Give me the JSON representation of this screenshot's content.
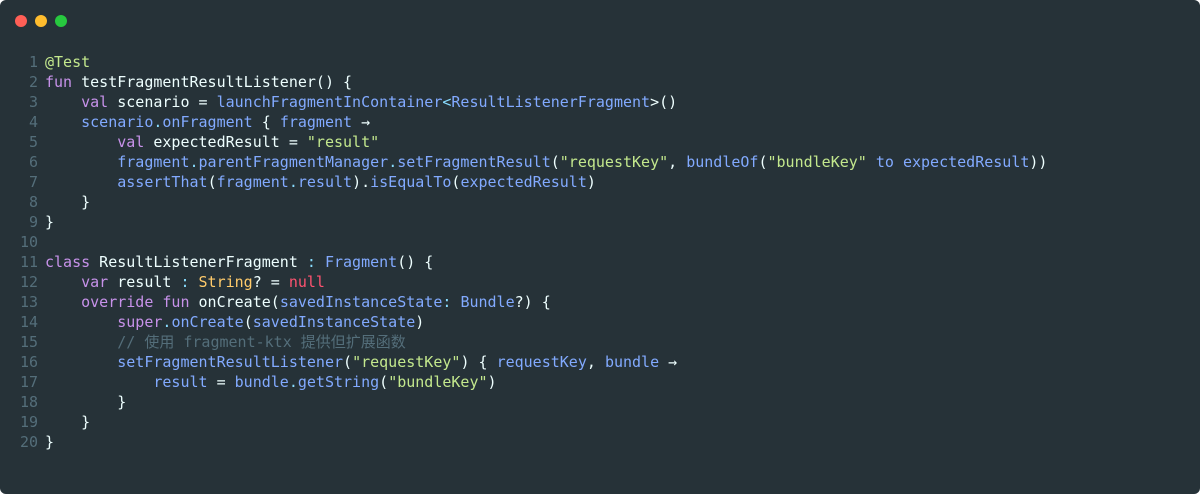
{
  "window": {
    "background": "#263238",
    "buttons": [
      {
        "name": "close",
        "color": "#ff5f56"
      },
      {
        "name": "minimize",
        "color": "#ffbd2e"
      },
      {
        "name": "maximize",
        "color": "#27c93f"
      }
    ]
  },
  "code": {
    "language": "kotlin",
    "lines": [
      {
        "n": "1",
        "tokens": [
          {
            "t": "@Test",
            "c": "#c3e88d"
          }
        ]
      },
      {
        "n": "2",
        "tokens": [
          {
            "t": "fun",
            "c": "#c792ea"
          },
          {
            "t": " testFragmentResultListener() {",
            "c": "#eeffff"
          }
        ]
      },
      {
        "n": "3",
        "tokens": [
          {
            "t": "    ",
            "c": "#eeffff"
          },
          {
            "t": "val",
            "c": "#c792ea"
          },
          {
            "t": " scenario = ",
            "c": "#eeffff"
          },
          {
            "t": "launchFragmentInContainer",
            "c": "#82aaff"
          },
          {
            "t": "<",
            "c": "#89ddff"
          },
          {
            "t": "ResultListenerFragment",
            "c": "#82aaff"
          },
          {
            "t": ">()",
            "c": "#eeffff"
          }
        ]
      },
      {
        "n": "4",
        "tokens": [
          {
            "t": "    ",
            "c": "#eeffff"
          },
          {
            "t": "scenario",
            "c": "#82aaff"
          },
          {
            "t": ".",
            "c": "#89ddff"
          },
          {
            "t": "onFragment",
            "c": "#82aaff"
          },
          {
            "t": " { ",
            "c": "#eeffff"
          },
          {
            "t": "fragment",
            "c": "#82aaff"
          },
          {
            "t": " →",
            "c": "#eeffff"
          }
        ]
      },
      {
        "n": "5",
        "tokens": [
          {
            "t": "        ",
            "c": "#eeffff"
          },
          {
            "t": "val",
            "c": "#c792ea"
          },
          {
            "t": " expectedResult = ",
            "c": "#eeffff"
          },
          {
            "t": "\"result\"",
            "c": "#c3e88d"
          }
        ]
      },
      {
        "n": "6",
        "tokens": [
          {
            "t": "        ",
            "c": "#eeffff"
          },
          {
            "t": "fragment",
            "c": "#82aaff"
          },
          {
            "t": ".",
            "c": "#89ddff"
          },
          {
            "t": "parentFragmentManager",
            "c": "#82aaff"
          },
          {
            "t": ".",
            "c": "#89ddff"
          },
          {
            "t": "setFragmentResult",
            "c": "#82aaff"
          },
          {
            "t": "(",
            "c": "#eeffff"
          },
          {
            "t": "\"requestKey\"",
            "c": "#c3e88d"
          },
          {
            "t": ", ",
            "c": "#eeffff"
          },
          {
            "t": "bundleOf",
            "c": "#82aaff"
          },
          {
            "t": "(",
            "c": "#eeffff"
          },
          {
            "t": "\"bundleKey\"",
            "c": "#c3e88d"
          },
          {
            "t": " ",
            "c": "#eeffff"
          },
          {
            "t": "to",
            "c": "#82aaff"
          },
          {
            "t": " ",
            "c": "#eeffff"
          },
          {
            "t": "expectedResult",
            "c": "#82aaff"
          },
          {
            "t": "))",
            "c": "#eeffff"
          }
        ]
      },
      {
        "n": "7",
        "tokens": [
          {
            "t": "        ",
            "c": "#eeffff"
          },
          {
            "t": "assertThat",
            "c": "#82aaff"
          },
          {
            "t": "(",
            "c": "#eeffff"
          },
          {
            "t": "fragment",
            "c": "#82aaff"
          },
          {
            "t": ".",
            "c": "#89ddff"
          },
          {
            "t": "result",
            "c": "#82aaff"
          },
          {
            "t": ").",
            "c": "#eeffff"
          },
          {
            "t": "isEqualTo",
            "c": "#82aaff"
          },
          {
            "t": "(",
            "c": "#eeffff"
          },
          {
            "t": "expectedResult",
            "c": "#82aaff"
          },
          {
            "t": ")",
            "c": "#eeffff"
          }
        ]
      },
      {
        "n": "8",
        "tokens": [
          {
            "t": "    }",
            "c": "#eeffff"
          }
        ]
      },
      {
        "n": "9",
        "tokens": [
          {
            "t": "}",
            "c": "#eeffff"
          }
        ]
      },
      {
        "n": "10",
        "tokens": []
      },
      {
        "n": "11",
        "tokens": [
          {
            "t": "class",
            "c": "#c792ea"
          },
          {
            "t": " ResultListenerFragment ",
            "c": "#eeffff"
          },
          {
            "t": ":",
            "c": "#89ddff"
          },
          {
            "t": " ",
            "c": "#eeffff"
          },
          {
            "t": "Fragment",
            "c": "#82aaff"
          },
          {
            "t": "() {",
            "c": "#eeffff"
          }
        ]
      },
      {
        "n": "12",
        "tokens": [
          {
            "t": "    ",
            "c": "#eeffff"
          },
          {
            "t": "var",
            "c": "#c792ea"
          },
          {
            "t": " result ",
            "c": "#eeffff"
          },
          {
            "t": ":",
            "c": "#89ddff"
          },
          {
            "t": " ",
            "c": "#eeffff"
          },
          {
            "t": "String",
            "c": "#ffcb6b"
          },
          {
            "t": "? = ",
            "c": "#eeffff"
          },
          {
            "t": "null",
            "c": "#ff5370"
          }
        ]
      },
      {
        "n": "13",
        "tokens": [
          {
            "t": "    ",
            "c": "#eeffff"
          },
          {
            "t": "override fun",
            "c": "#c792ea"
          },
          {
            "t": " onCreate(",
            "c": "#eeffff"
          },
          {
            "t": "savedInstanceState",
            "c": "#82aaff"
          },
          {
            "t": ": ",
            "c": "#89ddff"
          },
          {
            "t": "Bundle",
            "c": "#82aaff"
          },
          {
            "t": "?) {",
            "c": "#eeffff"
          }
        ]
      },
      {
        "n": "14",
        "tokens": [
          {
            "t": "        ",
            "c": "#eeffff"
          },
          {
            "t": "super",
            "c": "#c792ea"
          },
          {
            "t": ".",
            "c": "#89ddff"
          },
          {
            "t": "onCreate",
            "c": "#82aaff"
          },
          {
            "t": "(",
            "c": "#eeffff"
          },
          {
            "t": "savedInstanceState",
            "c": "#82aaff"
          },
          {
            "t": ")",
            "c": "#eeffff"
          }
        ]
      },
      {
        "n": "15",
        "tokens": [
          {
            "t": "        ",
            "c": "#eeffff"
          },
          {
            "t": "// 使用 fragment-ktx 提供但扩展函数",
            "c": "#546e7a"
          }
        ]
      },
      {
        "n": "16",
        "tokens": [
          {
            "t": "        ",
            "c": "#eeffff"
          },
          {
            "t": "setFragmentResultListener",
            "c": "#82aaff"
          },
          {
            "t": "(",
            "c": "#eeffff"
          },
          {
            "t": "\"requestKey\"",
            "c": "#c3e88d"
          },
          {
            "t": ") { ",
            "c": "#eeffff"
          },
          {
            "t": "requestKey",
            "c": "#82aaff"
          },
          {
            "t": ", ",
            "c": "#eeffff"
          },
          {
            "t": "bundle",
            "c": "#82aaff"
          },
          {
            "t": " →",
            "c": "#eeffff"
          }
        ]
      },
      {
        "n": "17",
        "tokens": [
          {
            "t": "            ",
            "c": "#eeffff"
          },
          {
            "t": "result",
            "c": "#82aaff"
          },
          {
            "t": " = ",
            "c": "#eeffff"
          },
          {
            "t": "bundle",
            "c": "#82aaff"
          },
          {
            "t": ".",
            "c": "#89ddff"
          },
          {
            "t": "getString",
            "c": "#82aaff"
          },
          {
            "t": "(",
            "c": "#eeffff"
          },
          {
            "t": "\"bundleKey\"",
            "c": "#c3e88d"
          },
          {
            "t": ")",
            "c": "#eeffff"
          }
        ]
      },
      {
        "n": "18",
        "tokens": [
          {
            "t": "        }",
            "c": "#eeffff"
          }
        ]
      },
      {
        "n": "19",
        "tokens": [
          {
            "t": "    }",
            "c": "#eeffff"
          }
        ]
      },
      {
        "n": "20",
        "tokens": [
          {
            "t": "}",
            "c": "#eeffff"
          }
        ]
      }
    ]
  }
}
